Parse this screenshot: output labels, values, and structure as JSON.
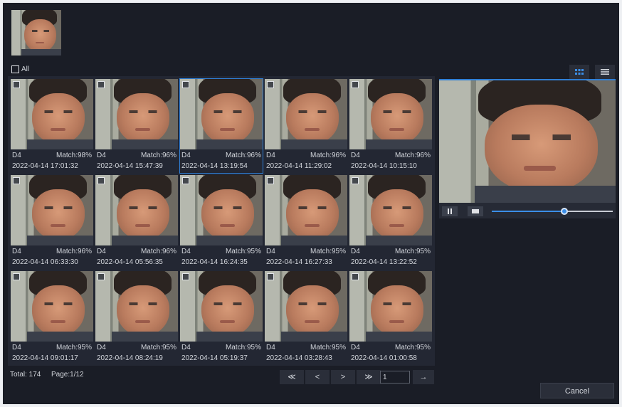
{
  "select_all": {
    "label": "All"
  },
  "results": [
    {
      "channel": "D4",
      "match": "Match:98%",
      "time": "2022-04-14 17:01:32"
    },
    {
      "channel": "D4",
      "match": "Match:96%",
      "time": "2022-04-14 15:47:39"
    },
    {
      "channel": "D4",
      "match": "Match:96%",
      "time": "2022-04-14 13:19:54"
    },
    {
      "channel": "D4",
      "match": "Match:96%",
      "time": "2022-04-14 11:29:02"
    },
    {
      "channel": "D4",
      "match": "Match:96%",
      "time": "2022-04-14 10:15:10"
    },
    {
      "channel": "D4",
      "match": "Match:96%",
      "time": "2022-04-14 06:33:30"
    },
    {
      "channel": "D4",
      "match": "Match:96%",
      "time": "2022-04-14 05:56:35"
    },
    {
      "channel": "D4",
      "match": "Match:95%",
      "time": "2022-04-14 16:24:35"
    },
    {
      "channel": "D4",
      "match": "Match:95%",
      "time": "2022-04-14 16:27:33"
    },
    {
      "channel": "D4",
      "match": "Match:95%",
      "time": "2022-04-14 13:22:52"
    },
    {
      "channel": "D4",
      "match": "Match:95%",
      "time": "2022-04-14 09:01:17"
    },
    {
      "channel": "D4",
      "match": "Match:95%",
      "time": "2022-04-14 08:24:19"
    },
    {
      "channel": "D4",
      "match": "Match:95%",
      "time": "2022-04-14 05:19:37"
    },
    {
      "channel": "D4",
      "match": "Match:95%",
      "time": "2022-04-14 03:28:43"
    },
    {
      "channel": "D4",
      "match": "Match:95%",
      "time": "2022-04-14 01:00:58"
    }
  ],
  "selected_index": 2,
  "footer": {
    "total": "Total: 174",
    "page": "Page:1/12"
  },
  "pagination": {
    "first": "≪",
    "prev": "<",
    "next": ">",
    "last": "≫",
    "page_value": "1",
    "go": "→"
  },
  "player": {
    "progress": 0.6
  },
  "view_toggle": {
    "grid_icon": "grid-view-icon",
    "list_icon": "list-view-icon"
  },
  "cancel_button": "Cancel",
  "colors": {
    "background": "#1a1d26",
    "accent": "#2f7fd6"
  }
}
